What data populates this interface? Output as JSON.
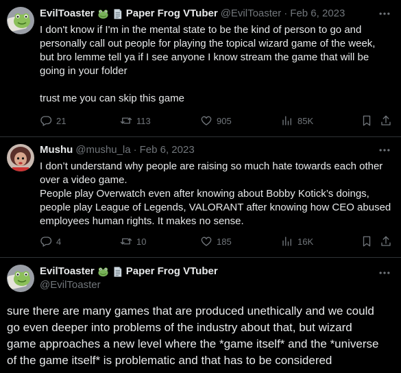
{
  "tweets": [
    {
      "name": "EvilToaster",
      "name_suffix": "Paper Frog VTuber",
      "handle": "@EvilToaster",
      "separator": "·",
      "date": "Feb 6, 2023",
      "text_lines": [
        "I don't know if I'm in the mental state to be the kind of person to go and",
        "personally call out people for playing the topical wizard game of the week,",
        "but bro lemme tell ya if I see anyone I know stream the game that will be",
        "going in your folder"
      ],
      "text_para2": "trust me you can skip this game",
      "replies": "21",
      "reposts": "113",
      "likes": "905",
      "views": "85K"
    },
    {
      "name": "Mushu",
      "handle": "@mushu_la",
      "separator": "·",
      "date": "Feb 6, 2023",
      "text_lines": [
        "I don’t understand why people are raising so much hate towards each other",
        "over a video game.",
        "People play Overwatch even after knowing about Bobby Kotick’s doings,",
        "people play League of Legends, VALORANT after knowing how CEO abused",
        "employees human rights. It makes no sense."
      ],
      "replies": "4",
      "reposts": "10",
      "likes": "185",
      "views": "16K"
    },
    {
      "name": "EvilToaster",
      "name_suffix": "Paper Frog VTuber",
      "handle": "@EvilToaster",
      "text_lines": [
        "sure there are many games that are produced unethically and we could",
        "go even deeper into problems of the industry about that, but wizard",
        "game approaches a new level where the *game itself* and the *universe",
        "of the game itself* is problematic and that has to be considered"
      ]
    }
  ],
  "icons": {
    "frog_emoji": "frog-emoji-icon",
    "scroll_emoji": "page-emoji-icon",
    "more": "more-icon",
    "reply": "reply-icon",
    "repost": "repost-icon",
    "like": "like-icon",
    "views": "views-icon",
    "bookmark": "bookmark-icon",
    "share": "share-icon"
  },
  "colors": {
    "background": "#000000",
    "text": "#e7e9ea",
    "muted": "#71767b",
    "divider": "#2f3336"
  }
}
